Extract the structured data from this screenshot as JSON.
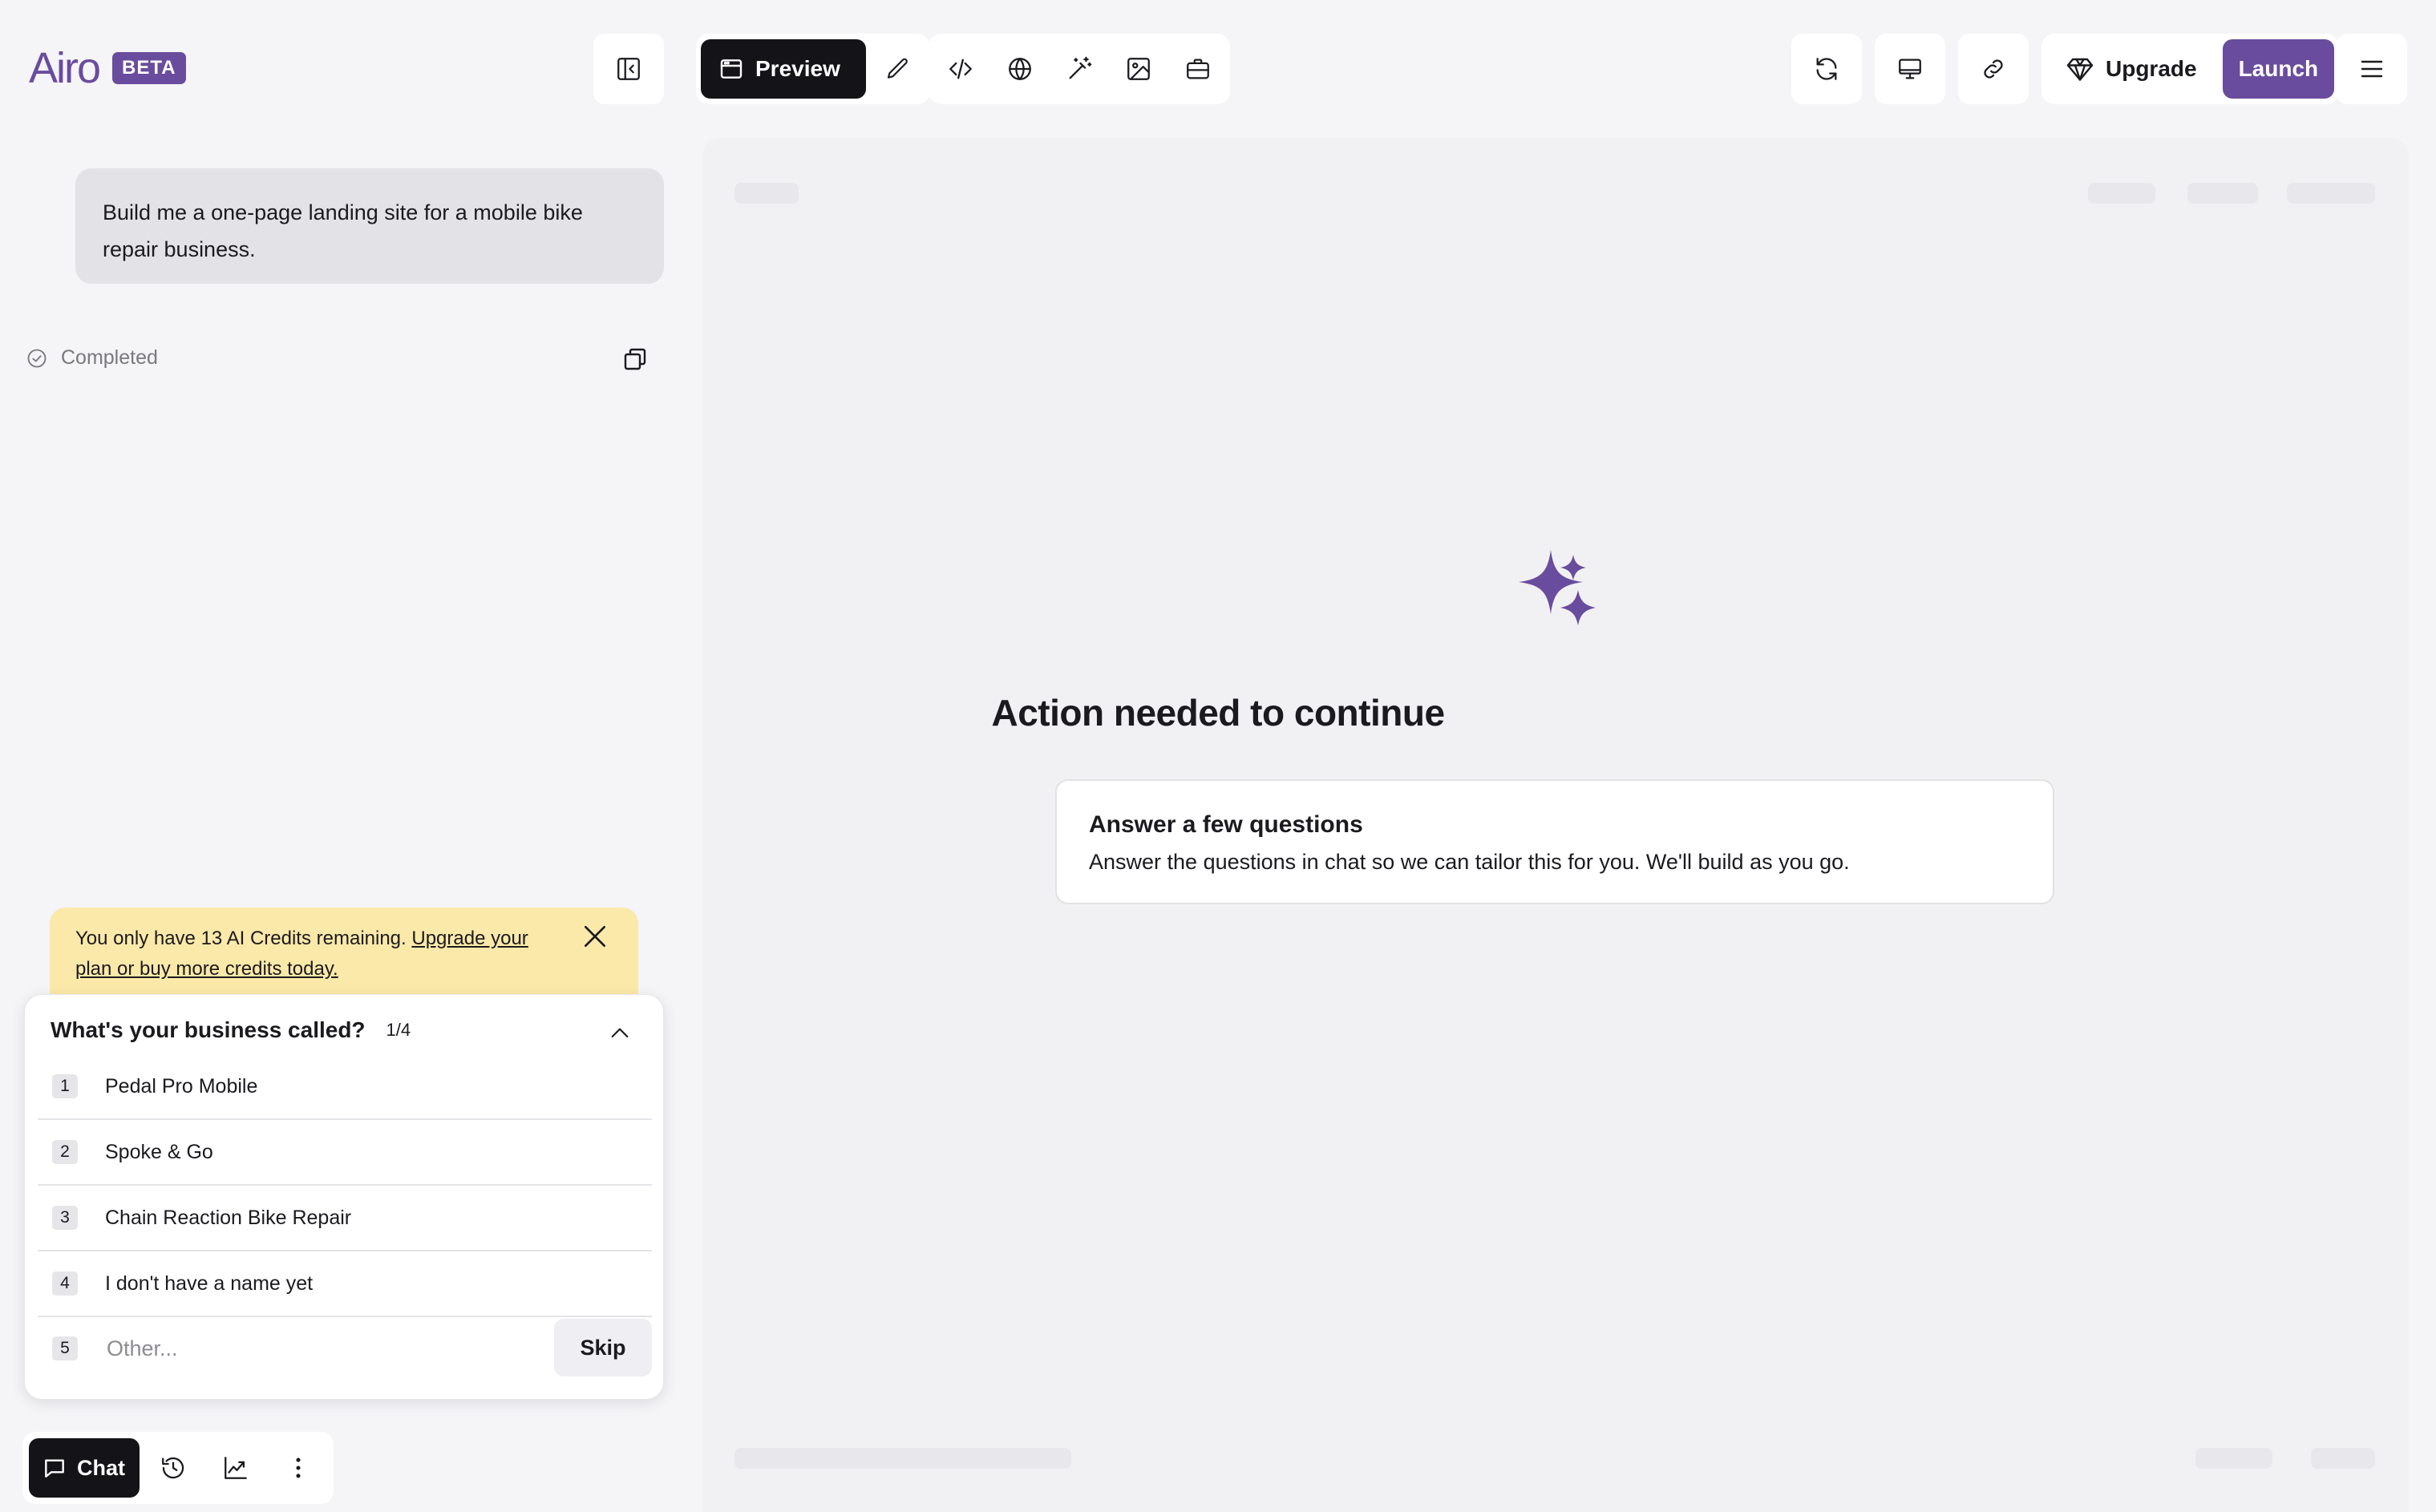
{
  "header": {
    "logo_text": "Airo",
    "beta_label": "BETA",
    "preview_label": "Preview",
    "upgrade_label": "Upgrade",
    "launch_label": "Launch"
  },
  "chat": {
    "user_message": "Build me a one-page landing site for a mobile bike repair business.",
    "status": "Completed",
    "credits_banner": {
      "text": "You only have 13 AI Credits remaining. ",
      "link": "Upgrade your plan or buy more credits today."
    },
    "question": {
      "title": "What's your business called?",
      "progress": "1/4",
      "options": [
        {
          "num": "1",
          "label": "Pedal Pro Mobile"
        },
        {
          "num": "2",
          "label": "Spoke & Go"
        },
        {
          "num": "3",
          "label": "Chain Reaction Bike Repair"
        },
        {
          "num": "4",
          "label": "I don't have a name yet"
        }
      ],
      "other_num": "5",
      "other_placeholder": "Other...",
      "skip_label": "Skip"
    }
  },
  "bottom_bar": {
    "chat_label": "Chat"
  },
  "preview": {
    "title": "Action needed to continue",
    "card_title": "Answer a few questions",
    "card_desc": "Answer the questions in chat so we can tailor this for you. We'll build as you go."
  },
  "colors": {
    "brand": "#6a4c9e",
    "dark": "#141318",
    "banner": "#fbe9a9",
    "background": "#f5f4f7"
  }
}
